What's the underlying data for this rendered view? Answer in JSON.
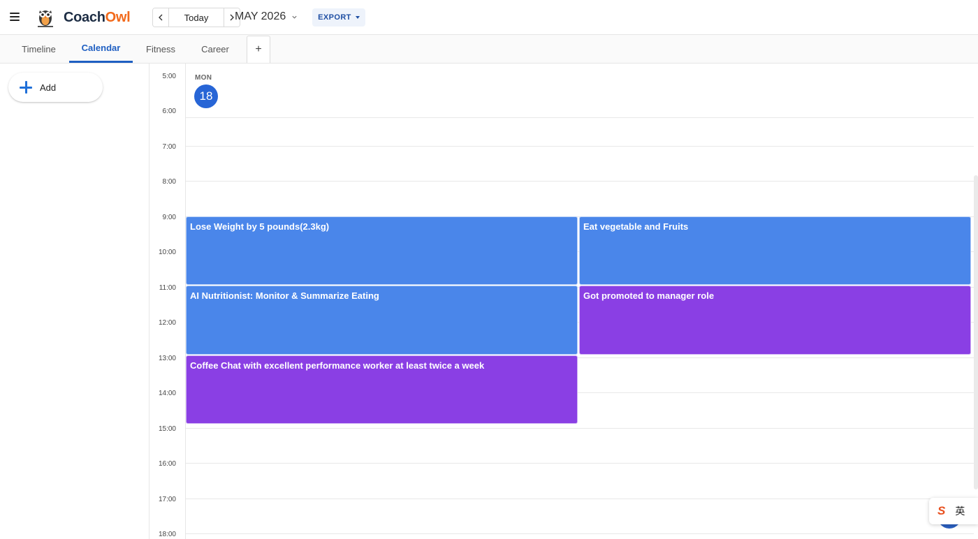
{
  "app": {
    "name_main": "Coach",
    "name_accent": "Owl",
    "logo_icon": "owl-logo-icon",
    "accent_color": "#f26a1b",
    "brand_color": "#1f5fc2"
  },
  "header": {
    "menu_icon": "hamburger-menu-icon",
    "prev_icon": "chevron-left-icon",
    "next_icon": "chevron-right-icon",
    "today_label": "Today",
    "month_label": "MAY 2026",
    "month_icon": "chevron-down-icon",
    "export_label": "EXPORT"
  },
  "tabs": [
    {
      "label": "Timeline",
      "active": false
    },
    {
      "label": "Calendar",
      "active": true
    },
    {
      "label": "Fitness",
      "active": false
    },
    {
      "label": "Career",
      "active": false
    }
  ],
  "tab_add_label": "+",
  "sidebar": {
    "add_label": "Add",
    "add_icon": "plus-icon"
  },
  "calendar": {
    "day_name": "MON",
    "day_number": "18",
    "hours": [
      "5:00",
      "6:00",
      "7:00",
      "8:00",
      "9:00",
      "10:00",
      "11:00",
      "12:00",
      "13:00",
      "14:00",
      "15:00",
      "16:00",
      "17:00",
      "18:00"
    ],
    "events": [
      {
        "title": "Lose Weight by 5 pounds(2.3kg)",
        "color": "blue",
        "start": "9:00",
        "end": "11:00",
        "column": 0
      },
      {
        "title": "Eat vegetable and Fruits",
        "color": "blue",
        "start": "9:00",
        "end": "11:00",
        "column": 1
      },
      {
        "title": "AI Nutritionist: Monitor & Summarize Eating",
        "color": "blue",
        "start": "11:00",
        "end": "13:00",
        "column": 0
      },
      {
        "title": "Got promoted to manager role",
        "color": "purple",
        "start": "11:00",
        "end": "13:00",
        "column": 1
      },
      {
        "title": "Coffee Chat with excellent performance worker at least twice a week",
        "color": "purple",
        "start": "13:00",
        "end": "15:00",
        "column": 0
      }
    ],
    "event_colors": {
      "blue": "#4a86ea",
      "purple": "#8a3fe4"
    }
  },
  "ime": {
    "logo_text": "S",
    "lang_label": "英"
  }
}
